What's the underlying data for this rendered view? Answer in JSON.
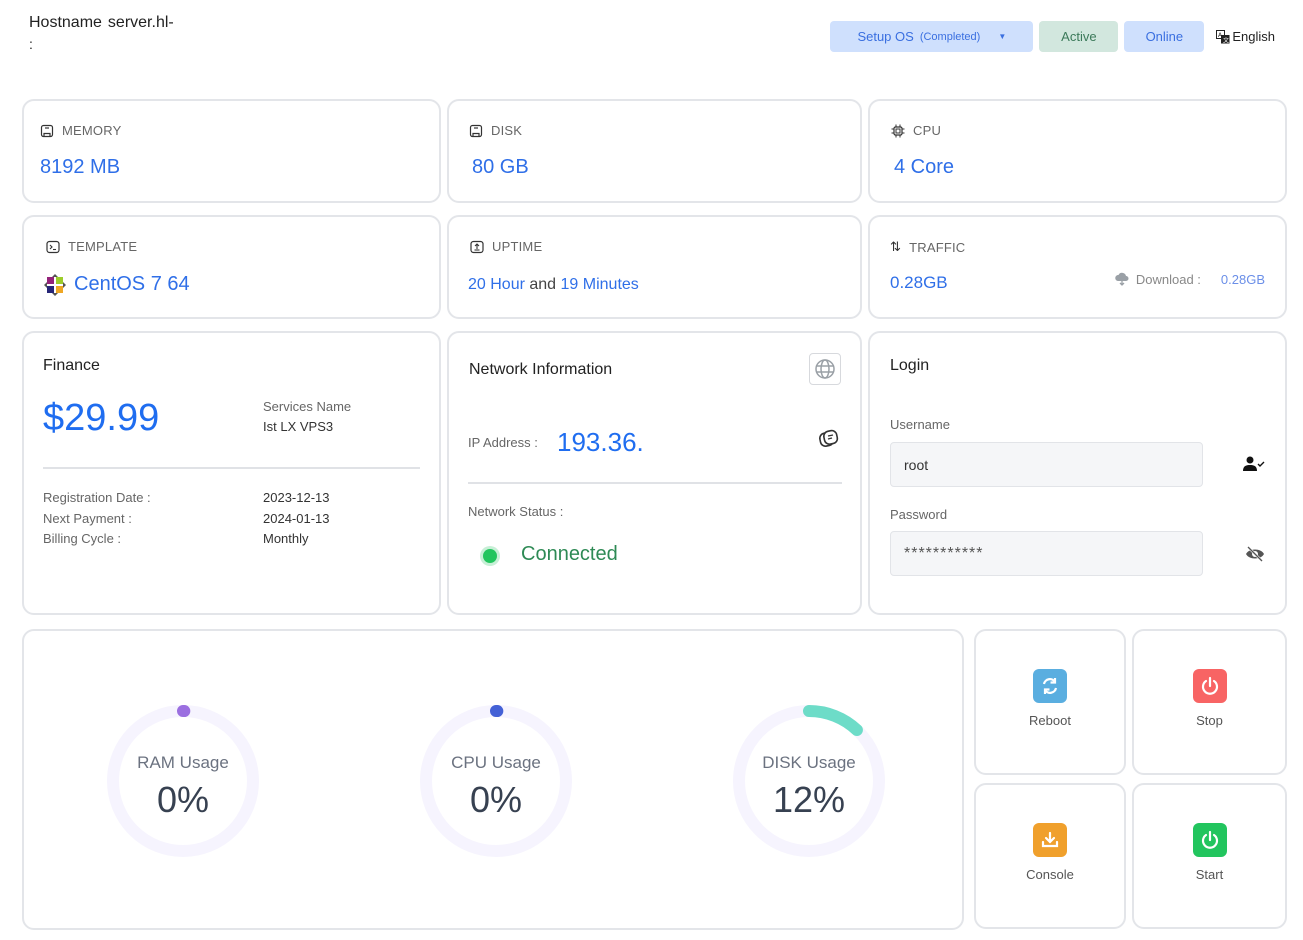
{
  "header": {
    "hostname_label": "Hostname",
    "hostname_value": "server.hl-",
    "hostname_colon": ":",
    "setup_os": {
      "label": "Setup OS",
      "status": "(Completed)"
    },
    "active_label": "Active",
    "online_label": "Online",
    "language": "English"
  },
  "stats": {
    "memory": {
      "label": "MEMORY",
      "value": "8192 MB",
      "icon": "memory-icon"
    },
    "disk": {
      "label": "DISK",
      "value": "80 GB",
      "icon": "disk-icon"
    },
    "cpu": {
      "label": "CPU",
      "value": "4 Core",
      "icon": "cpu-icon"
    },
    "template": {
      "label": "TEMPLATE",
      "value": "CentOS 7 64",
      "icon": "terminal-icon"
    },
    "uptime": {
      "label": "UPTIME",
      "hours": "20 Hour",
      "and": "and",
      "minutes": "19 Minutes",
      "icon": "upload-icon"
    },
    "traffic": {
      "label": "TRAFFIC",
      "value": "0.28GB",
      "download_label": "Download :",
      "download_value": "0.28GB",
      "icon": "arrows-updown-icon"
    }
  },
  "finance": {
    "title": "Finance",
    "price": "$29.99",
    "services_name_label": "Services Name",
    "services_name_value": "Ist LX VPS3",
    "rows": [
      {
        "label": "Registration Date :",
        "value": "2023-12-13"
      },
      {
        "label": "Next Payment :",
        "value": "2024-01-13"
      },
      {
        "label": "Billing Cycle :",
        "value": "Monthly"
      }
    ]
  },
  "network": {
    "title": "Network Information",
    "ip_label": "IP Address :",
    "ip_value": "193.36.",
    "status_label": "Network Status :",
    "status_value": "Connected"
  },
  "login": {
    "title": "Login",
    "username_label": "Username",
    "username_value": "root",
    "password_label": "Password",
    "password_value": "***********"
  },
  "usage": [
    {
      "label": "RAM Usage",
      "value": "0%",
      "percent": 0,
      "color": "#9b6fe0"
    },
    {
      "label": "CPU Usage",
      "value": "0%",
      "percent": 0,
      "color": "#4461d6"
    },
    {
      "label": "DISK Usage",
      "value": "12%",
      "percent": 12,
      "color": "#6ddcc8"
    }
  ],
  "actions": [
    {
      "label": "Reboot",
      "color": "#5aaee0",
      "icon": "refresh-icon"
    },
    {
      "label": "Stop",
      "color": "#f86464",
      "icon": "power-icon"
    },
    {
      "label": "Console",
      "color": "#f0a02c",
      "icon": "download-icon"
    },
    {
      "label": "Start",
      "color": "#22c55e",
      "icon": "power-icon"
    }
  ],
  "colors": {
    "accent": "#2f6fe8",
    "border": "#e3e5e9",
    "track": "#f6f4fe"
  }
}
